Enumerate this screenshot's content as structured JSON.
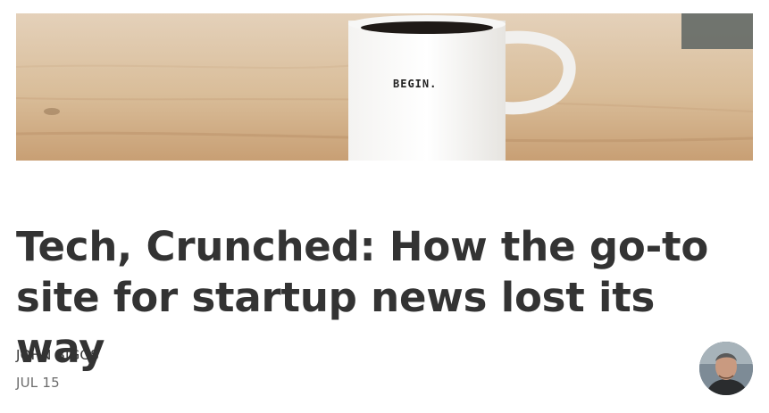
{
  "hero": {
    "mug_text": "BEGIN."
  },
  "article": {
    "title": "Tech, Crunched: How the go-to site for startup news lost its way",
    "author": "JOHN BIGGS",
    "date": "JUL 15"
  },
  "colors": {
    "title": "#333333",
    "author": "#333333",
    "date": "#6b6b6b"
  }
}
